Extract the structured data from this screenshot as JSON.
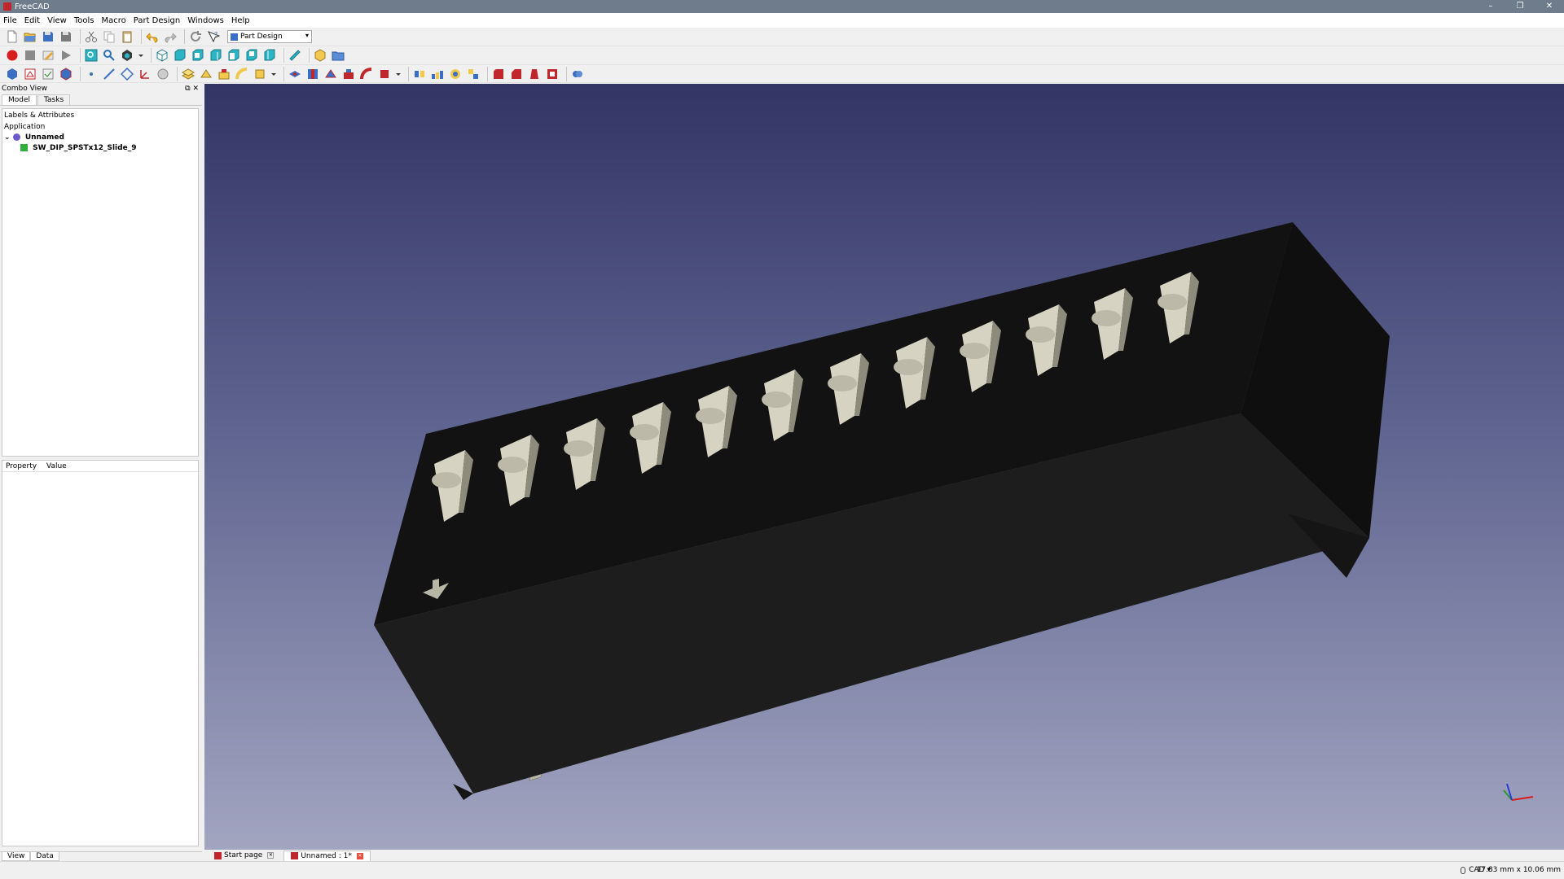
{
  "window": {
    "title": "FreeCAD",
    "controls": [
      "–",
      "❐",
      "✕"
    ]
  },
  "menu": [
    "File",
    "Edit",
    "View",
    "Tools",
    "Macro",
    "Part Design",
    "Windows",
    "Help"
  ],
  "workbench": {
    "selected": "Part Design"
  },
  "combo_view": {
    "title": "Combo View",
    "tabs": [
      "Model",
      "Tasks"
    ],
    "tree": {
      "header": "Labels & Attributes",
      "section": "Application",
      "document": "Unnamed",
      "object": "SW_DIP_SPSTx12_Slide_9"
    },
    "property": {
      "col1": "Property",
      "col2": "Value"
    },
    "bottom_tabs": [
      "View",
      "Data"
    ]
  },
  "doc_tabs": [
    {
      "label": "Start page",
      "active": false
    },
    {
      "label": "Unnamed : 1*",
      "active": true
    }
  ],
  "status": {
    "nav_style": "CAD",
    "dimensions": "17.83 mm x 10.06 mm"
  },
  "colors": {
    "viewport_top": "#333565",
    "viewport_bottom": "#a2a5c0",
    "body": "#1d1d1d",
    "switch": "#d6d3c2"
  },
  "icons": [
    "new-file-icon",
    "open-file-icon",
    "save-icon",
    "save-as-icon",
    "cut-icon",
    "copy-icon",
    "paste-icon",
    "undo-icon",
    "redo-icon",
    "refresh-icon",
    "whats-this-icon"
  ]
}
